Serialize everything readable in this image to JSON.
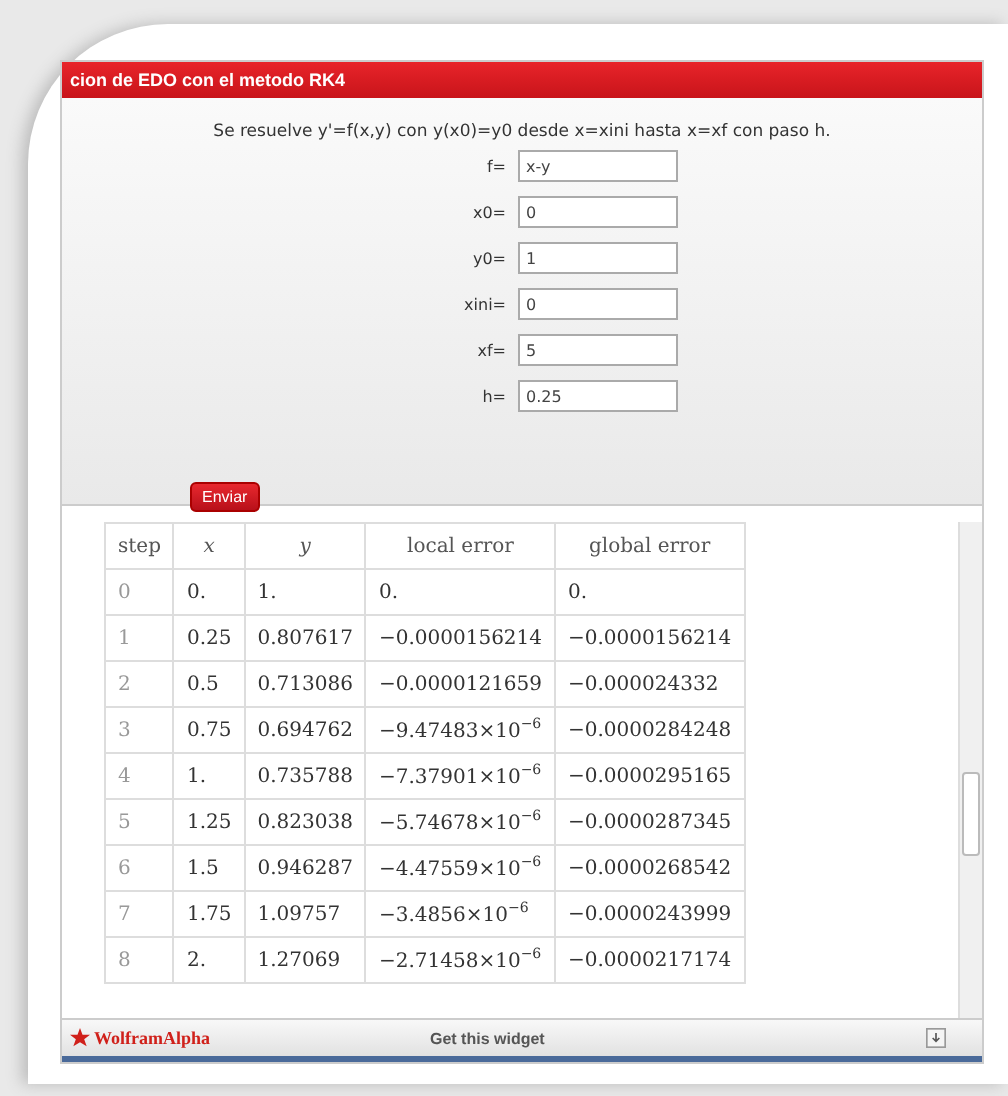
{
  "widget": {
    "title": "cion de EDO con el metodo RK4",
    "description": "Se resuelve y'=f(x,y) con y(x0)=y0 desde x=xini hasta x=xf con paso h.",
    "fields": [
      {
        "label": "f=",
        "value": "x-y"
      },
      {
        "label": "x0=",
        "value": "0"
      },
      {
        "label": "y0=",
        "value": "1"
      },
      {
        "label": "xini=",
        "value": "0"
      },
      {
        "label": "xf=",
        "value": "5"
      },
      {
        "label": "h=",
        "value": "0.25"
      }
    ],
    "submit": "Enviar"
  },
  "table": {
    "columns": [
      "step",
      "x",
      "y",
      "local error",
      "global error"
    ],
    "rows": [
      [
        "0",
        "0.",
        "1.",
        "0.",
        "0."
      ],
      [
        "1",
        "0.25",
        "0.807617",
        "−0.0000156214",
        "−0.0000156214"
      ],
      [
        "2",
        "0.5",
        "0.713086",
        "−0.0000121659",
        "−0.000024332"
      ],
      [
        "3",
        "0.75",
        "0.694762",
        "−9.47483×10$^{−6}$",
        "−0.0000284248"
      ],
      [
        "4",
        "1.",
        "0.735788",
        "−7.37901×10$^{−6}$",
        "−0.0000295165"
      ],
      [
        "5",
        "1.25",
        "0.823038",
        "−5.74678×10$^{−6}$",
        "−0.0000287345"
      ],
      [
        "6",
        "1.5",
        "0.946287",
        "−4.47559×10$^{−6}$",
        "−0.0000268542"
      ],
      [
        "7",
        "1.75",
        "1.09757",
        "−3.4856×10$^{−6}$",
        "−0.0000243999"
      ],
      [
        "8",
        "2.",
        "1.27069",
        "−2.71458×10$^{−6}$",
        "−0.0000217174"
      ]
    ]
  },
  "footer": {
    "logo": "WolframAlpha",
    "link": "Get this widget"
  }
}
